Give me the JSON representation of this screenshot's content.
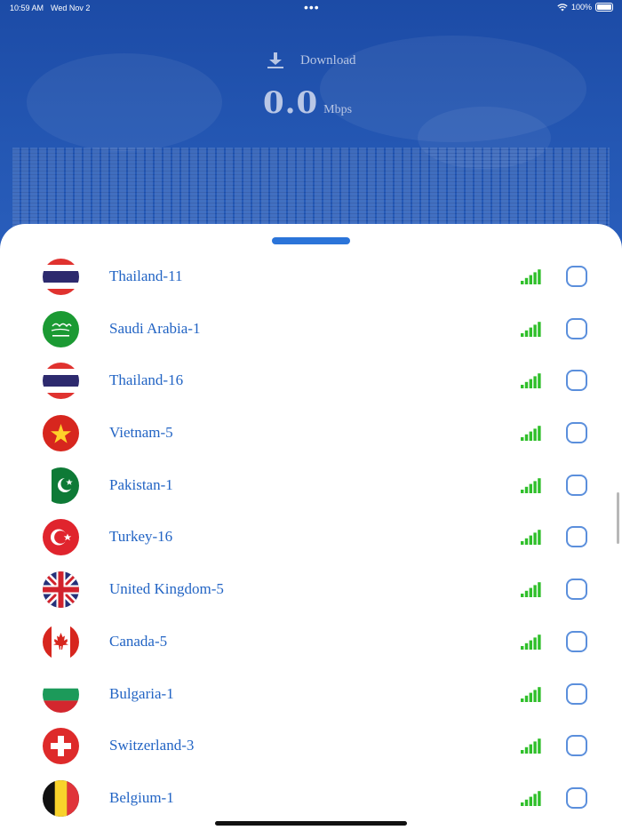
{
  "status_bar": {
    "time": "10:59 AM",
    "date": "Wed Nov 2",
    "dots": "•••",
    "battery": "100%"
  },
  "header": {
    "download_label": "Download",
    "speed_value": "0.0",
    "speed_unit": "Mbps"
  },
  "colors": {
    "header_blue": "#1f4fa8",
    "accent_blue": "#2264c4",
    "signal_green": "#2fbf2a",
    "handle_blue": "#2b74d9"
  },
  "servers": [
    {
      "name": "Thailand-11",
      "flag": "thailand-flag-icon",
      "signal_bars": 4,
      "selected": false
    },
    {
      "name": "Saudi Arabia-1",
      "flag": "saudi-arabia-flag-icon",
      "signal_bars": 4,
      "selected": false
    },
    {
      "name": "Thailand-16",
      "flag": "thailand-flag-icon",
      "signal_bars": 4,
      "selected": false
    },
    {
      "name": "Vietnam-5",
      "flag": "vietnam-flag-icon",
      "signal_bars": 4,
      "selected": false
    },
    {
      "name": "Pakistan-1",
      "flag": "pakistan-flag-icon",
      "signal_bars": 4,
      "selected": false
    },
    {
      "name": "Turkey-16",
      "flag": "turkey-flag-icon",
      "signal_bars": 4,
      "selected": false
    },
    {
      "name": "United Kingdom-5",
      "flag": "united-kingdom-flag-icon",
      "signal_bars": 4,
      "selected": false
    },
    {
      "name": "Canada-5",
      "flag": "canada-flag-icon",
      "signal_bars": 4,
      "selected": false
    },
    {
      "name": "Bulgaria-1",
      "flag": "bulgaria-flag-icon",
      "signal_bars": 4,
      "selected": false
    },
    {
      "name": "Switzerland-3",
      "flag": "switzerland-flag-icon",
      "signal_bars": 4,
      "selected": false
    },
    {
      "name": "Belgium-1",
      "flag": "belgium-flag-icon",
      "signal_bars": 4,
      "selected": false
    }
  ]
}
